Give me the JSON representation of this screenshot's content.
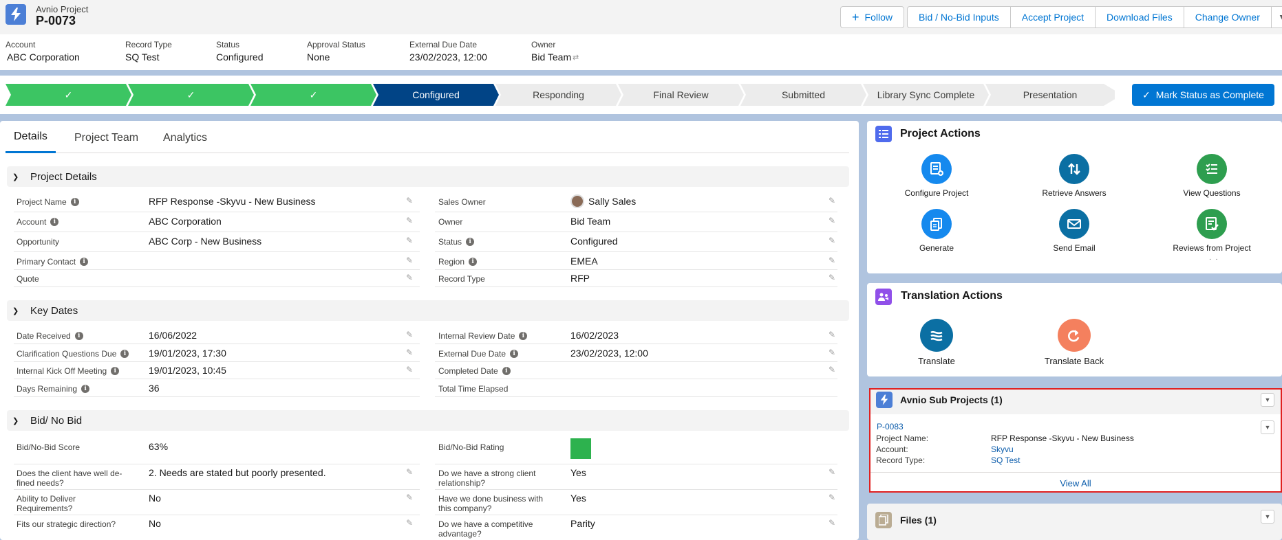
{
  "header": {
    "object_label": "Avnio Project",
    "record_name": "P-0073",
    "buttons": {
      "follow": "Follow",
      "bid_inputs": "Bid / No-Bid Inputs",
      "accept": "Accept Project",
      "download": "Download Files",
      "change_owner": "Change Owner"
    },
    "fields": {
      "account_label": "Account",
      "account_value": "ABC Corporation",
      "record_type_label": "Record Type",
      "record_type_value": "SQ Test",
      "status_label": "Status",
      "status_value": "Configured",
      "approval_label": "Approval Status",
      "approval_value": "None",
      "due_label": "External Due Date",
      "due_value": "23/02/2023, 12:00",
      "owner_label": "Owner",
      "owner_value": "Bid Team"
    }
  },
  "path": {
    "stages": [
      "Configured",
      "Responding",
      "Final Review",
      "Submitted",
      "Library Sync Complete",
      "Presentation"
    ],
    "mark_button": "Mark Status as Complete"
  },
  "tabs": [
    "Details",
    "Project Team",
    "Analytics"
  ],
  "sections": {
    "project_details": "Project Details",
    "key_dates": "Key Dates",
    "bid": "Bid/ No Bid"
  },
  "project_details": {
    "left": [
      {
        "label": "Project Name",
        "value": "RFP Response -Skyvu - New Business"
      },
      {
        "label": "Account",
        "value": "ABC Corporation"
      },
      {
        "label": "Opportunity",
        "value": "ABC Corp - New Business"
      },
      {
        "label": "Primary Contact",
        "value": ""
      },
      {
        "label": "Quote",
        "value": ""
      }
    ],
    "right": [
      {
        "label": "Sales Owner",
        "value": "Sally Sales"
      },
      {
        "label": "Owner",
        "value": "Bid Team"
      },
      {
        "label": "Status",
        "value": "Configured"
      },
      {
        "label": "Region",
        "value": "EMEA"
      },
      {
        "label": "Record Type",
        "value": "RFP"
      }
    ]
  },
  "key_dates": {
    "left": [
      {
        "label": "Date Received",
        "value": "16/06/2022"
      },
      {
        "label": "Clarification Questions Due",
        "value": "19/01/2023, 17:30"
      },
      {
        "label": "Internal Kick Off Meeting",
        "value": "19/01/2023, 10:45"
      },
      {
        "label": "Days Remaining",
        "value": "36"
      }
    ],
    "right": [
      {
        "label": "Internal Review Date",
        "value": "16/02/2023"
      },
      {
        "label": "External Due Date",
        "value": "23/02/2023, 12:00"
      },
      {
        "label": "Completed Date",
        "value": ""
      },
      {
        "label": "Total Time Elapsed",
        "value": ""
      }
    ]
  },
  "bid": {
    "left": [
      {
        "label": "Bid/No-Bid Score",
        "value": "63%"
      },
      {
        "label": "Does the client have well de-fined needs?",
        "value": "2. Needs are stated but poorly presented."
      },
      {
        "label": "Ability to Deliver Requirements?",
        "value": "No"
      },
      {
        "label": "Fits our strategic direction?",
        "value": "No"
      }
    ],
    "right": [
      {
        "label": "Bid/No-Bid Rating",
        "value": ""
      },
      {
        "label": "Do we have a strong client relationship?",
        "value": "Yes"
      },
      {
        "label": "Have we done business with this company?",
        "value": "Yes"
      },
      {
        "label": "Do we have a competitive advantage?",
        "value": "Parity"
      }
    ],
    "rating_color": "#2db24e"
  },
  "project_actions": {
    "title": "Project Actions",
    "items": [
      "Configure Project",
      "Retrieve Answers",
      "View Questions",
      "Generate",
      "Send Email",
      "Reviews from Project"
    ]
  },
  "translation_actions": {
    "title": "Translation Actions",
    "items": [
      "Translate",
      "Translate Back"
    ]
  },
  "sub_projects": {
    "title": "Avnio Sub Projects (1)",
    "record": "P-0083",
    "fields": [
      {
        "label": "Project Name:",
        "value": "RFP Response -Skyvu - New Business"
      },
      {
        "label": "Account:",
        "value": "Skyvu"
      },
      {
        "label": "Record Type:",
        "value": "SQ Test"
      }
    ],
    "view_all": "View All"
  },
  "files": {
    "title": "Files (1)"
  },
  "colors": {
    "brand": "#0176d3",
    "done": "#3cc563",
    "current": "#014486",
    "highlight": "#e02020"
  }
}
